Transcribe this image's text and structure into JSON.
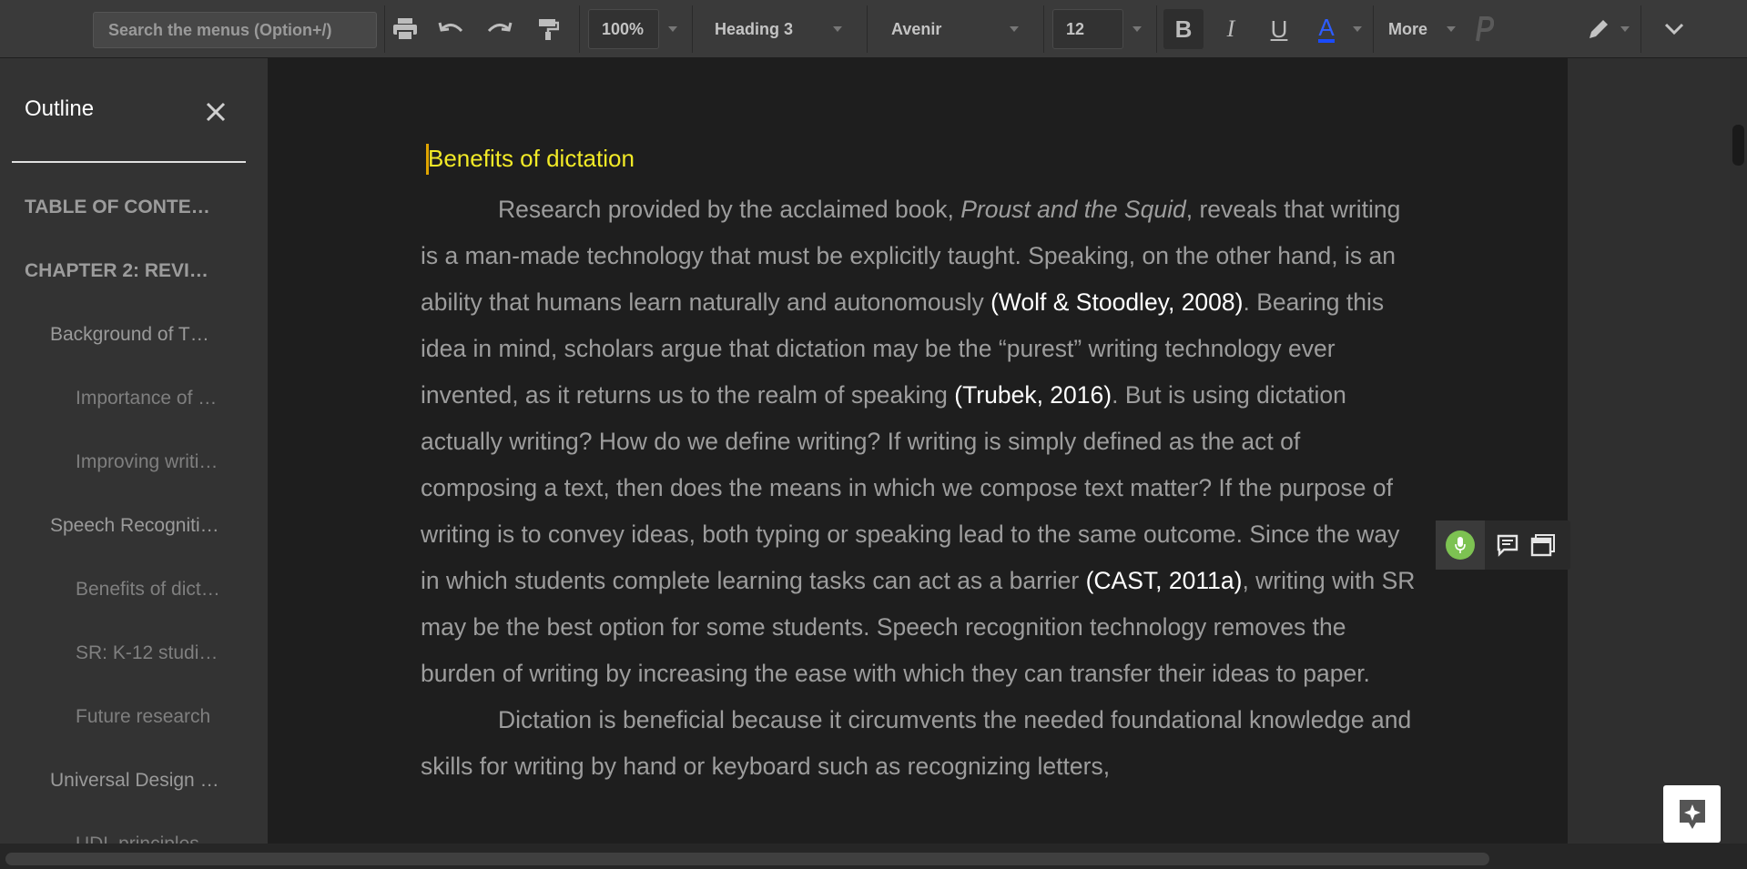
{
  "toolbar": {
    "search_placeholder": "Search the menus (Option+/)",
    "zoom": "100%",
    "style": "Heading 3",
    "font": "Avenir",
    "font_size": "12",
    "bold": "B",
    "italic": "I",
    "underline": "U",
    "text_color": "A",
    "text_color_hex": "#1a4bff",
    "more": "More"
  },
  "outline": {
    "title": "Outline",
    "items": [
      {
        "label": "TABLE OF CONTE…",
        "level": 1
      },
      {
        "label": "CHAPTER 2: REVI…",
        "level": 1
      },
      {
        "label": "Background of T…",
        "level": 2
      },
      {
        "label": "Importance of …",
        "level": 3
      },
      {
        "label": "Improving writi…",
        "level": 3
      },
      {
        "label": "Speech Recogniti…",
        "level": 2
      },
      {
        "label": "Benefits of dict…",
        "level": 3
      },
      {
        "label": "SR: K-12 studi…",
        "level": 3
      },
      {
        "label": "Future research",
        "level": 3
      },
      {
        "label": "Universal Design …",
        "level": 2
      },
      {
        "label": "UDL principles…",
        "level": 3
      }
    ]
  },
  "document": {
    "heading": "Benefits of dictation",
    "p1": {
      "a": "Research provided by the acclaimed book, ",
      "b_italic": "Proust and the Squid",
      "c": ", reveals that writing is a man-made technology that must be explicitly taught. Speaking, on the other hand,  is an ability that humans learn naturally and autonomously ",
      "cite1": "(Wolf & Stoodley, 2008)",
      "d": ".  Bearing this idea in mind, scholars argue that dictation may be the “purest” writing technology ever invented, as it returns us to the realm of speaking ",
      "cite2": "(Trubek, 2016)",
      "e": ".   But is using dictation actually writing? How do we define writing?  If writing is simply defined as the act of composing a text, then does the means in which we compose text matter? If the purpose of writing is to convey ideas, both typing or speaking lead to the same outcome.  Since the way in which students complete learning tasks can act as a barrier ",
      "cite3": "(CAST, 2011a)",
      "f": ", writing with SR may be the best option for some students.  Speech recognition technology removes the burden of writing by increasing the ease with which they can transfer their ideas to paper."
    },
    "p2": {
      "a": "Dictation is beneficial because it circumvents the needed foundational knowledge and skills for writing by hand or keyboard such as recognizing letters, "
    }
  },
  "colors": {
    "heading": "#f2ea27",
    "mic": "#7dc252",
    "citation": "#ffffff"
  },
  "icons": [
    "print-icon",
    "undo-icon",
    "redo-icon",
    "paint-format-icon",
    "paste-p-icon",
    "pencil-icon",
    "chevron-down-icon",
    "close-icon",
    "microphone-icon",
    "comment-icon",
    "window-icon",
    "explore-icon"
  ]
}
